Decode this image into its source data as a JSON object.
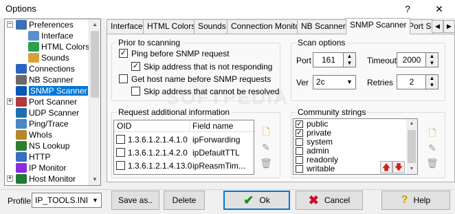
{
  "window": {
    "title": "Options",
    "help_glyph": "?",
    "close_glyph": "✕"
  },
  "tree": {
    "items": [
      {
        "label": "Preferences",
        "icon": "preferences-icon",
        "expander": "−"
      },
      {
        "label": "Interface",
        "icon": "interface-icon"
      },
      {
        "label": "HTML Colors",
        "icon": "html-colors-icon"
      },
      {
        "label": "Sounds",
        "icon": "sounds-icon"
      },
      {
        "label": "Connections",
        "icon": "connections-icon"
      },
      {
        "label": "NB Scanner",
        "icon": "nb-scanner-icon"
      },
      {
        "label": "SNMP Scanner",
        "icon": "snmp-scanner-icon",
        "selected": true
      },
      {
        "label": "Port Scanner",
        "icon": "port-scanner-icon",
        "expander": "+"
      },
      {
        "label": "UDP Scanner",
        "icon": "udp-scanner-icon"
      },
      {
        "label": "Ping/Trace",
        "icon": "ping-trace-icon"
      },
      {
        "label": "WhoIs",
        "icon": "whois-icon"
      },
      {
        "label": "NS Lookup",
        "icon": "ns-lookup-icon"
      },
      {
        "label": "HTTP",
        "icon": "http-icon"
      },
      {
        "label": "IP Monitor",
        "icon": "ip-monitor-icon"
      },
      {
        "label": "Host Monitor",
        "icon": "host-monitor-icon",
        "expander": "+"
      }
    ]
  },
  "tabs": [
    {
      "label": "Interface"
    },
    {
      "label": "HTML Colors"
    },
    {
      "label": "Sounds"
    },
    {
      "label": "Connection Monitor"
    },
    {
      "label": "NB Scanner"
    },
    {
      "label": "SNMP Scanner",
      "active": true
    },
    {
      "label": "Port Sc"
    }
  ],
  "prior": {
    "legend": "Prior to scanning",
    "ping_label": "Ping before SNMP request",
    "ping_checked": true,
    "skip_nr_label": "Skip address that is not responding",
    "skip_nr_checked": true,
    "host_label": "Get host name before SNMP requests",
    "host_checked": false,
    "skip_nr2_label": "Skip address that cannot be resolved",
    "skip_nr2_checked": false
  },
  "scan": {
    "legend": "Scan options",
    "port_label": "Port",
    "port_value": "161",
    "timeout_label": "Timeout",
    "timeout_value": "2000",
    "ver_label": "Ver",
    "ver_value": "2c",
    "retries_label": "Retries",
    "retries_value": "2"
  },
  "request": {
    "legend": "Request additional information",
    "col_oid": "OID",
    "col_field": "Field name",
    "rows": [
      {
        "oid": "1.3.6.1.2.1.4.1.0",
        "field": "ipForwarding",
        "checked": false
      },
      {
        "oid": "1.3.6.1.2.1.4.2.0",
        "field": "ipDefaultTTL",
        "checked": false
      },
      {
        "oid": "1.3.6.1.2.1.4.13.0",
        "field": "ipReasmTim...",
        "checked": false
      }
    ]
  },
  "community": {
    "legend": "Community strings",
    "items": [
      {
        "label": "public",
        "checked": true
      },
      {
        "label": "private",
        "checked": true
      },
      {
        "label": "system",
        "checked": false
      },
      {
        "label": "admin",
        "checked": false
      },
      {
        "label": "readonly",
        "checked": false
      },
      {
        "label": "writable",
        "checked": false
      }
    ]
  },
  "bottom": {
    "profile_label": "Profile",
    "profile_value": "IP_TOOLS.INI",
    "save_as": "Save as..",
    "delete": "Delete",
    "ok": "Ok",
    "cancel": "Cancel",
    "help": "Help"
  },
  "watermark": "SOFTPEDIA",
  "colors": {
    "selection": "#0078d7",
    "ok_check": "#1a8a1a",
    "cancel_x": "#c8102e",
    "arrow_red": "#d42020"
  }
}
